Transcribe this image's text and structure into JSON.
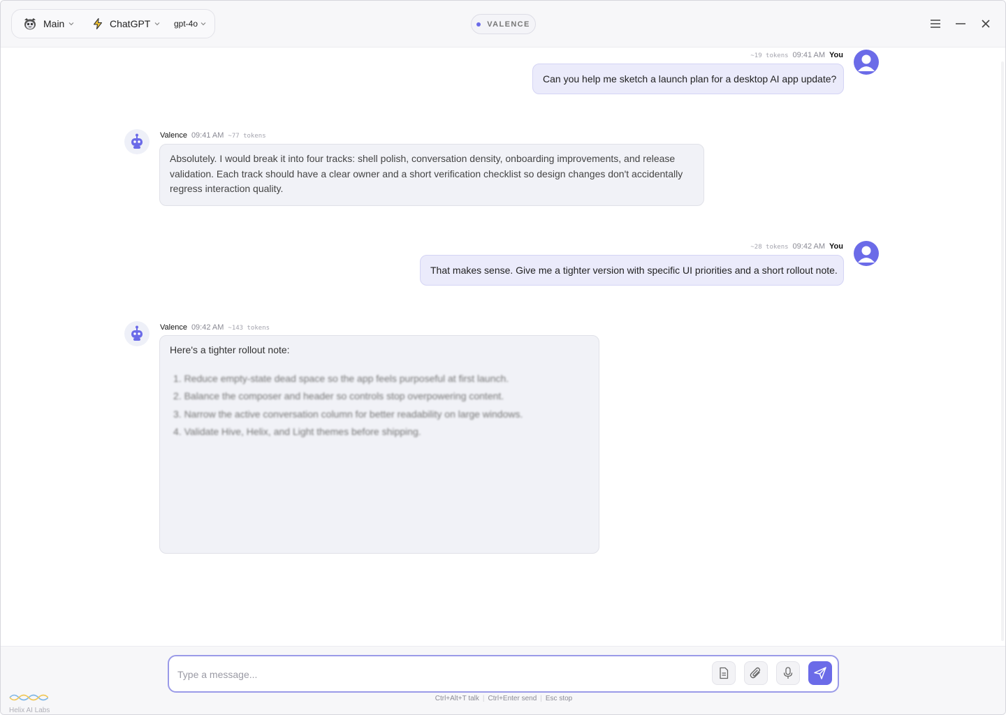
{
  "header": {
    "workspace_label": "Main",
    "provider_label": "ChatGPT",
    "model_label": "gpt-4o",
    "app_badge": "VALENCE"
  },
  "messages": [
    {
      "role": "user",
      "author": "You",
      "time": "09:41 AM",
      "tokens": "~19 tokens",
      "text": "Can you help me sketch a launch plan for a desktop AI app update?"
    },
    {
      "role": "assistant",
      "author": "Valence",
      "time": "09:41 AM",
      "tokens": "~77 tokens",
      "text": "Absolutely. I would break it into four tracks: shell polish, conversation density, onboarding improvements, and release validation. Each track should have a clear owner and a short verification checklist so design changes don't accidentally regress interaction quality."
    },
    {
      "role": "user",
      "author": "You",
      "time": "09:42 AM",
      "tokens": "~28 tokens",
      "text": "That makes sense. Give me a tighter version with specific UI priorities and a short rollout note."
    },
    {
      "role": "assistant",
      "author": "Valence",
      "time": "09:42 AM",
      "tokens": "~143 tokens",
      "text": "Here's a tighter rollout note:",
      "items": [
        "1. Reduce empty-state dead space so the app feels purposeful at first launch.",
        "2. Balance the composer and header so controls stop overpowering content.",
        "3. Narrow the active conversation column for better readability on large windows.",
        "4. Validate Hive, Helix, and Light themes before shipping."
      ]
    }
  ],
  "composer": {
    "placeholder": "Type a message..."
  },
  "shortcuts": {
    "talk": "Ctrl+Alt+T talk",
    "send": "Ctrl+Enter send",
    "stop": "Esc stop"
  },
  "brand": {
    "name": "Helix AI Labs"
  },
  "colors": {
    "accent": "#6b6be8",
    "user_bubble": "#ebebfb",
    "assistant_bubble": "#f1f2f7",
    "header_bg": "#f7f7f9"
  },
  "icons": [
    "app-logo-icon",
    "bolt-icon",
    "chevron-down-icon",
    "menu-icon",
    "minimize-icon",
    "close-icon",
    "user-avatar-icon",
    "robot-avatar-icon",
    "document-icon",
    "paperclip-icon",
    "microphone-icon",
    "send-icon",
    "helix-logo-icon"
  ]
}
